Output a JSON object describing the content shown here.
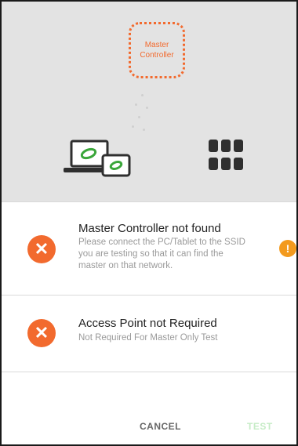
{
  "diagram": {
    "master_label_line1": "Master",
    "master_label_line2": "Controller"
  },
  "checks": [
    {
      "title": "Master Controller not found",
      "description": "Please connect the PC/Tablet to the SSID you are testing so that it can find the master on that network.",
      "status_icon": "close-icon",
      "warning_icon": "alert-icon"
    },
    {
      "title": "Access Point not Required",
      "description": "Not Required For Master Only Test",
      "status_icon": "close-icon"
    }
  ],
  "actions": {
    "cancel_label": "CANCEL",
    "test_label": "TEST"
  },
  "colors": {
    "accent": "#f26a2e",
    "warning": "#f39a1e",
    "test_disabled": "#c6ecc6",
    "header_bg": "#e3e3e3"
  }
}
